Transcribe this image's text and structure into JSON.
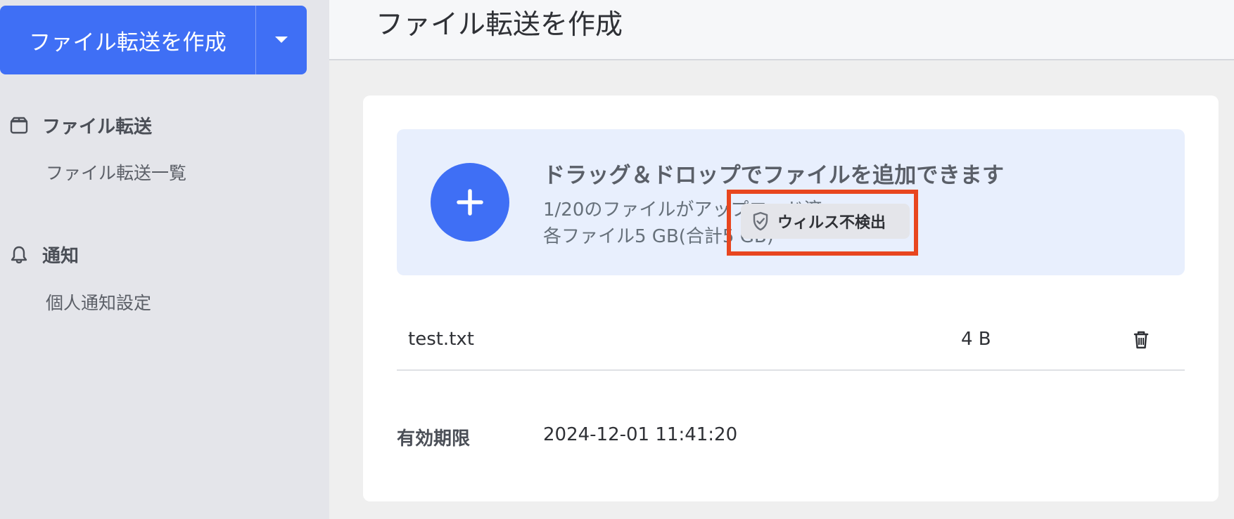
{
  "sidebar": {
    "create_button_label": "ファイル転送を作成",
    "dropdown_icon": "caret-down-icon",
    "sections": [
      {
        "title": "ファイル転送",
        "icon": "box-icon",
        "items": [
          "ファイル転送一覧"
        ]
      },
      {
        "title": "通知",
        "icon": "bell-icon",
        "items": [
          "個人通知設定"
        ]
      }
    ]
  },
  "header": {
    "title": "ファイル転送を作成"
  },
  "upload": {
    "title": "ドラッグ＆ドロップでファイルを追加できます",
    "progress_text": "1/20のファイルがアップロード済",
    "limit_text": "各ファイル5 GB(合計5 GB)"
  },
  "files": [
    {
      "name": "test.txt",
      "status": "ウィルス不検出",
      "status_icon": "shield-check-icon",
      "size": "4 B",
      "delete_icon": "trash-icon"
    }
  ],
  "expiry": {
    "label": "有効期限",
    "value": "2024-12-01 11:41:20"
  },
  "colors": {
    "primary": "#3f6ff5",
    "highlight": "#e8461f",
    "dropzone_bg": "#e8effd",
    "sidebar_bg": "#e4e5ea"
  }
}
